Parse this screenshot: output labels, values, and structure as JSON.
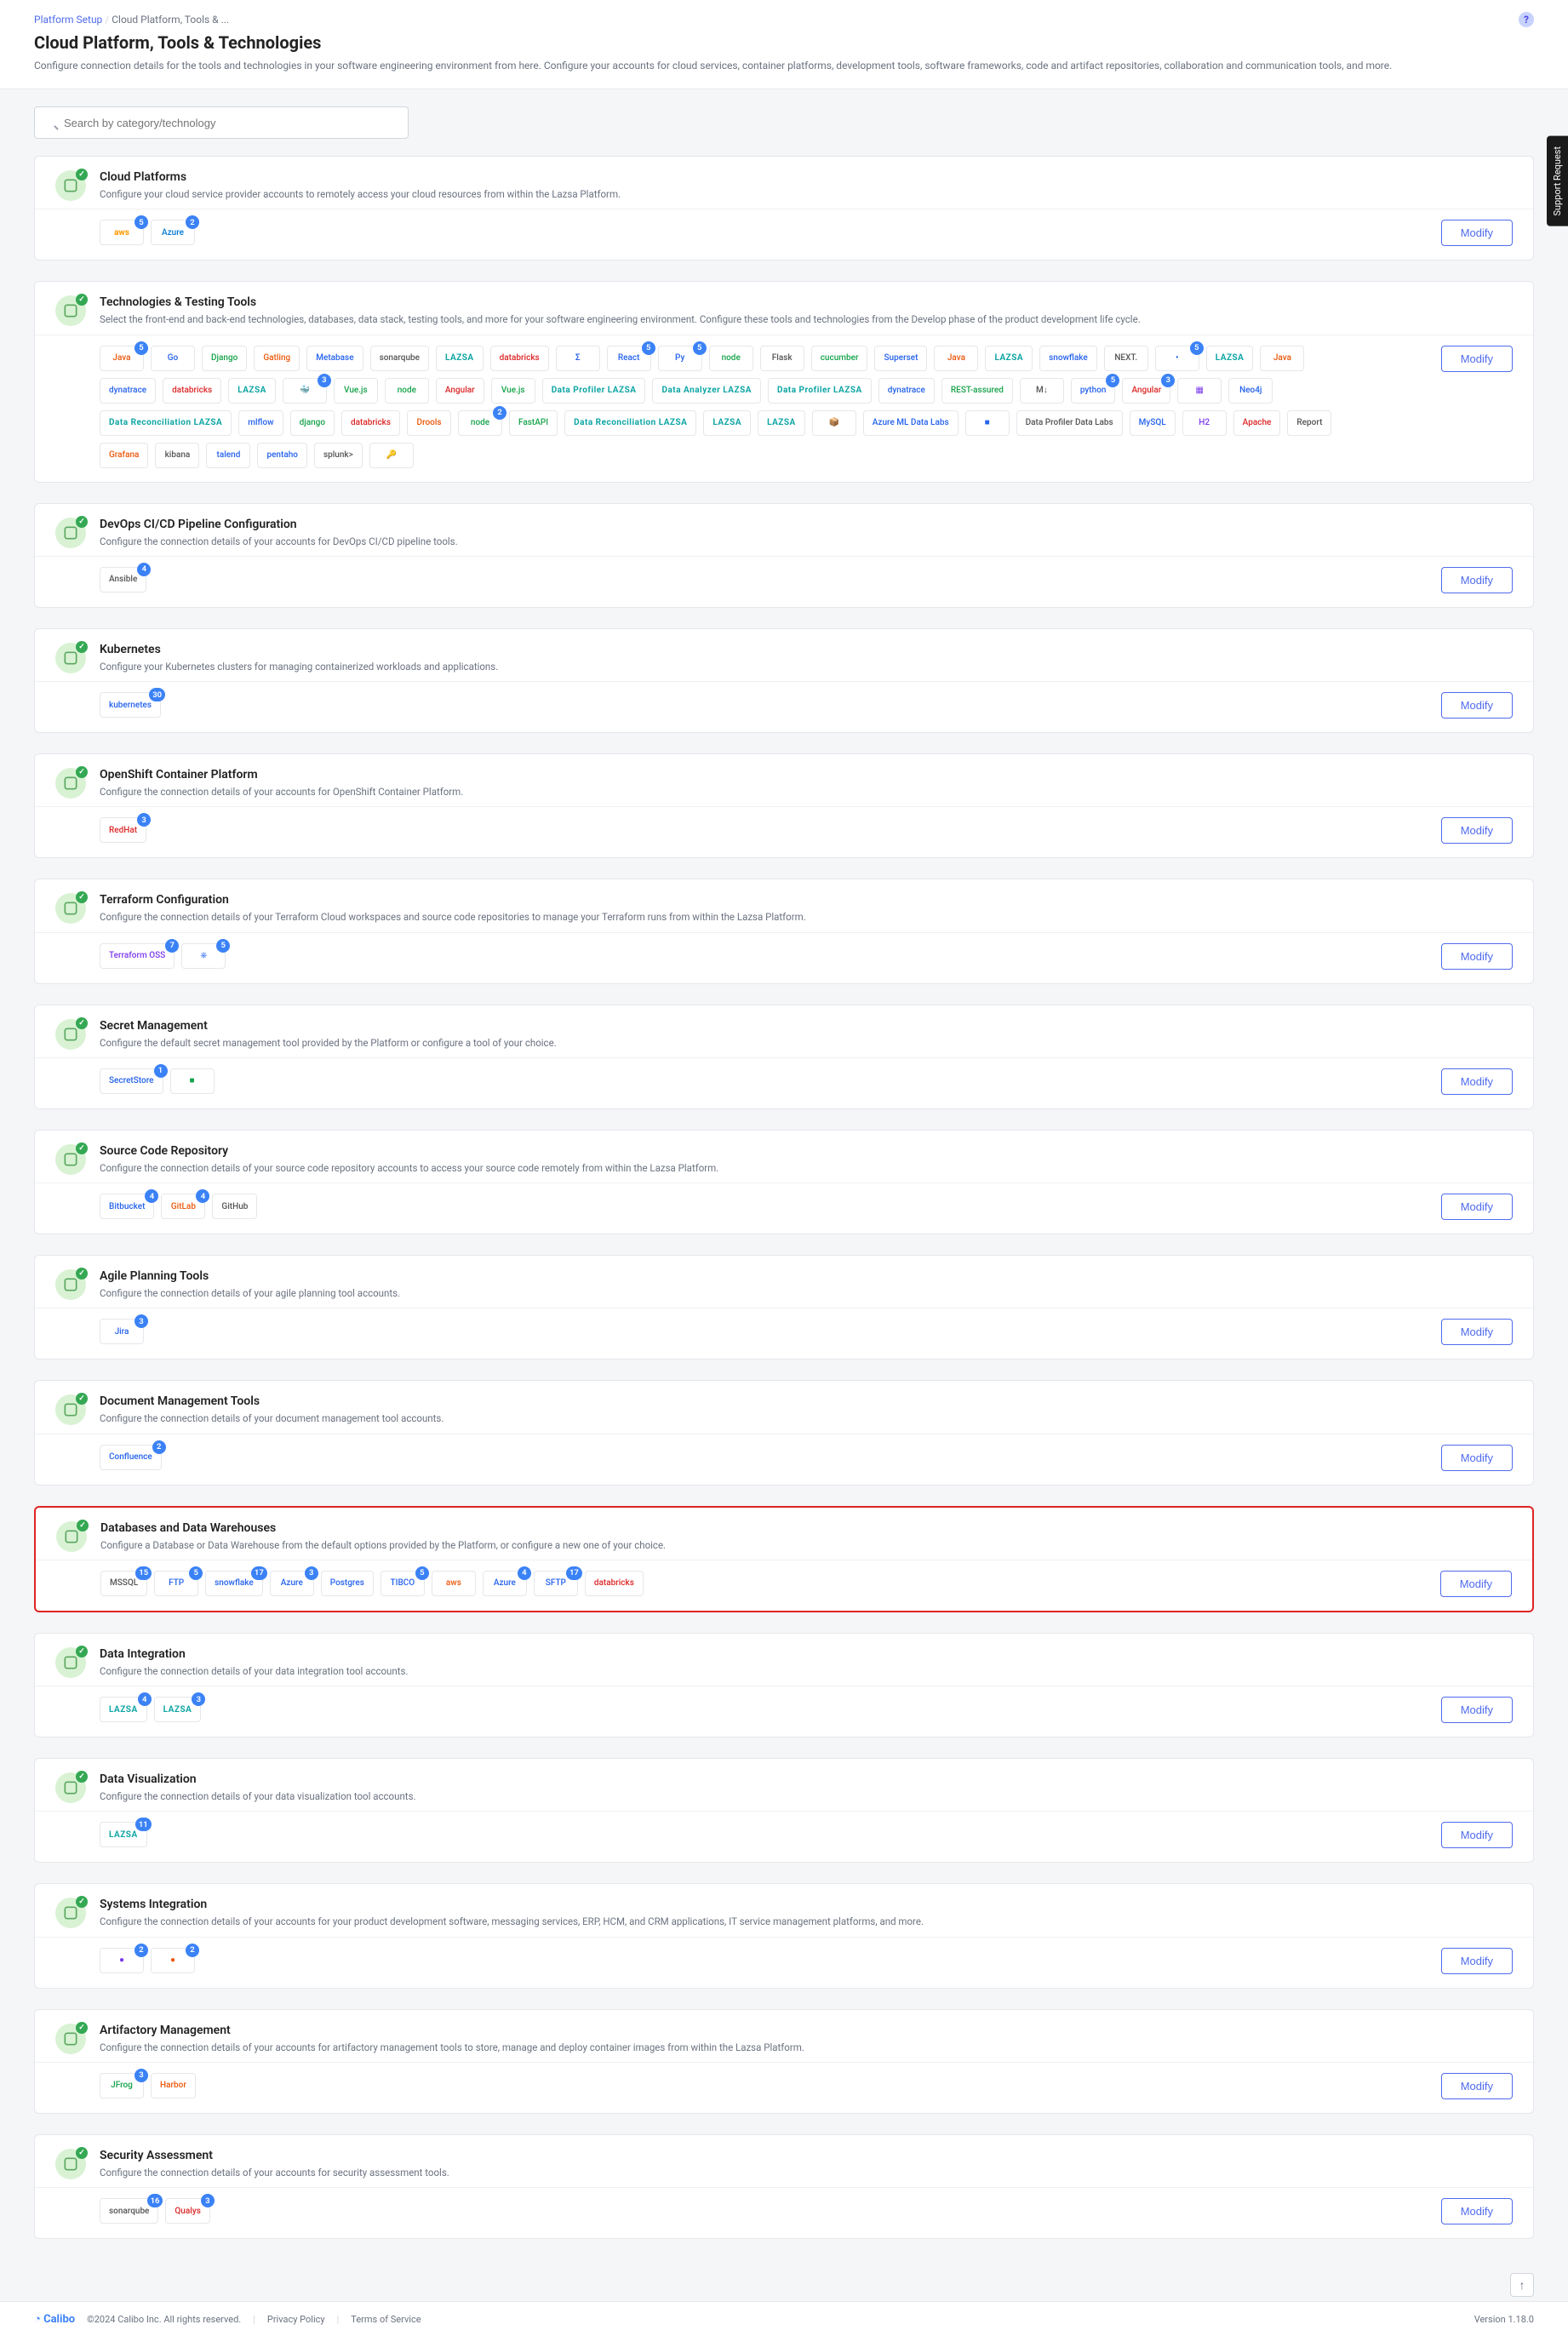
{
  "breadcrumb": {
    "root": "Platform Setup",
    "current": "Cloud Platform, Tools & ..."
  },
  "page_title": "Cloud Platform, Tools & Technologies",
  "page_subtitle": "Configure connection details for the tools and technologies in your software engineering environment from here. Configure your accounts for cloud services, container platforms, development tools, software frameworks, code and artifact repositories, collaboration and communication tools, and more.",
  "search_placeholder": "Search by category/technology",
  "modify_label": "Modify",
  "support_tab": "Support Request",
  "footer": {
    "brand": "Calibo",
    "copyright": "©2024 Calibo Inc. All rights reserved.",
    "privacy": "Privacy Policy",
    "terms": "Terms of Service",
    "version": "Version 1.18.0"
  },
  "cards": [
    {
      "id": "cloud-platforms",
      "title": "Cloud Platforms",
      "desc": "Configure your cloud service provider accounts to remotely access your cloud resources from within the Lazsa Platform.",
      "tiles": [
        {
          "name": "aws",
          "label": "aws",
          "badge": "5",
          "cls": "aws"
        },
        {
          "name": "azure",
          "label": "Azure",
          "badge": "2",
          "cls": "azure"
        }
      ]
    },
    {
      "id": "technologies-testing",
      "title": "Technologies & Testing Tools",
      "desc": "Select the front-end and back-end technologies, databases, data stack, testing tools, and more for your software engineering environment. Configure these tools and technologies from the Develop phase of the product development life cycle.",
      "tiles": [
        {
          "name": "java",
          "label": "Java",
          "badge": "5",
          "cls": "orange"
        },
        {
          "name": "go",
          "label": "Go",
          "badge": "",
          "cls": "blue"
        },
        {
          "name": "django-core",
          "label": "Django",
          "badge": "",
          "cls": "green"
        },
        {
          "name": "gatling",
          "label": "Gatling",
          "badge": "",
          "cls": "orange"
        },
        {
          "name": "metabase",
          "label": "Metabase",
          "badge": "",
          "cls": "blue"
        },
        {
          "name": "sonar1",
          "label": "sonarqube",
          "badge": "",
          "cls": ""
        },
        {
          "name": "lazsa-1",
          "label": "LAZSA",
          "badge": "",
          "cls": "lazsa"
        },
        {
          "name": "databricks-1",
          "label": "databricks",
          "badge": "",
          "cls": "red"
        },
        {
          "name": "sigma",
          "label": "Σ",
          "badge": "",
          "cls": "blue"
        },
        {
          "name": "react",
          "label": "React",
          "badge": "5",
          "cls": "blue"
        },
        {
          "name": "python",
          "label": "Py",
          "badge": "5",
          "cls": "blue"
        },
        {
          "name": "node-1",
          "label": "node",
          "badge": "",
          "cls": "green"
        },
        {
          "name": "flask",
          "label": "Flask",
          "badge": "",
          "cls": ""
        },
        {
          "name": "cucumber",
          "label": "cucumber",
          "badge": "",
          "cls": "green"
        },
        {
          "name": "superset",
          "label": "Superset",
          "badge": "",
          "cls": "blue"
        },
        {
          "name": "java-e",
          "label": "Java",
          "badge": "",
          "cls": "orange"
        },
        {
          "name": "lazsa-2",
          "label": "LAZSA",
          "badge": "",
          "cls": "lazsa"
        },
        {
          "name": "snowflake-1",
          "label": "snowflake",
          "badge": "",
          "cls": "blue"
        },
        {
          "name": "next",
          "label": "NEXT.",
          "badge": "",
          "cls": ""
        },
        {
          "name": "misc1",
          "label": "•",
          "badge": "5",
          "cls": "blue"
        },
        {
          "name": "lazsa-3",
          "label": "LAZSA",
          "badge": "",
          "cls": "lazsa"
        },
        {
          "name": "java2",
          "label": "Java",
          "badge": "",
          "cls": "orange"
        },
        {
          "name": "dynatrace",
          "label": "dynatrace",
          "badge": "",
          "cls": "blue"
        },
        {
          "name": "databricks2",
          "label": "databricks",
          "badge": "",
          "cls": "red"
        },
        {
          "name": "lazsa-4",
          "label": "LAZSA",
          "badge": "",
          "cls": "lazsa"
        },
        {
          "name": "docker",
          "label": "🐳",
          "badge": "3",
          "cls": "blue"
        },
        {
          "name": "vue",
          "label": "Vue.js",
          "badge": "",
          "cls": "green"
        },
        {
          "name": "node-2",
          "label": "node",
          "badge": "",
          "cls": "green"
        },
        {
          "name": "angular",
          "label": "Angular",
          "badge": "",
          "cls": "red"
        },
        {
          "name": "vuejs2",
          "label": "Vue.js",
          "badge": "",
          "cls": "green"
        },
        {
          "name": "data-profiler1",
          "label": "Data Profiler LAZSA",
          "badge": "",
          "cls": "lazsa"
        },
        {
          "name": "data-analyzer",
          "label": "Data Analyzer LAZSA",
          "badge": "",
          "cls": "lazsa"
        },
        {
          "name": "data-profiler2",
          "label": "Data Profiler LAZSA",
          "badge": "",
          "cls": "lazsa"
        },
        {
          "name": "dynatrace2",
          "label": "dynatrace",
          "badge": "",
          "cls": "blue"
        },
        {
          "name": "restassured",
          "label": "REST-assured",
          "badge": "",
          "cls": "green"
        },
        {
          "name": "markdown",
          "label": "M↓",
          "badge": "",
          "cls": ""
        },
        {
          "name": "python2",
          "label": "python",
          "badge": "5",
          "cls": "blue"
        },
        {
          "name": "angular2",
          "label": "Angular",
          "badge": "3",
          "cls": "red"
        },
        {
          "name": "apigw",
          "label": "▦",
          "badge": "",
          "cls": "purple"
        },
        {
          "name": "neo4j",
          "label": "Neo4j",
          "badge": "",
          "cls": "blue"
        },
        {
          "name": "data-recon",
          "label": "Data Reconciliation LAZSA",
          "badge": "",
          "cls": "lazsa"
        },
        {
          "name": "mlflow-1",
          "label": "mlflow",
          "badge": "",
          "cls": "blue"
        },
        {
          "name": "django-2",
          "label": "django",
          "badge": "",
          "cls": "green"
        },
        {
          "name": "databricks4",
          "label": "databricks",
          "badge": "",
          "cls": "red"
        },
        {
          "name": "drools",
          "label": "Drools",
          "badge": "",
          "cls": "orange"
        },
        {
          "name": "node-3",
          "label": "node",
          "badge": "2",
          "cls": "green"
        },
        {
          "name": "fastapi",
          "label": "FastAPI",
          "badge": "",
          "cls": "green"
        },
        {
          "name": "data-recon2",
          "label": "Data Reconciliation LAZSA",
          "badge": "",
          "cls": "lazsa"
        },
        {
          "name": "lazsa-6",
          "label": "LAZSA",
          "badge": "",
          "cls": "lazsa"
        },
        {
          "name": "lazsa-7",
          "label": "LAZSA",
          "badge": "",
          "cls": "lazsa"
        },
        {
          "name": "box",
          "label": "📦",
          "badge": "",
          "cls": ""
        },
        {
          "name": "azure-dl",
          "label": "Azure ML Data Labs",
          "badge": "",
          "cls": "blue"
        },
        {
          "name": "gemfire",
          "label": "■",
          "badge": "",
          "cls": "blue"
        },
        {
          "name": "data-profiler3",
          "label": "Data Profiler Data Labs",
          "badge": "",
          "cls": ""
        },
        {
          "name": "mysql",
          "label": "MySQL",
          "badge": "",
          "cls": "blue"
        },
        {
          "name": "h2",
          "label": "H2",
          "badge": "",
          "cls": "purple"
        },
        {
          "name": "apache",
          "label": "Apache",
          "badge": "",
          "cls": "red"
        },
        {
          "name": "report",
          "label": "Report",
          "badge": "",
          "cls": ""
        },
        {
          "name": "grafana",
          "label": "Grafana",
          "badge": "",
          "cls": "orange"
        },
        {
          "name": "kibana",
          "label": "kibana",
          "badge": "",
          "cls": ""
        },
        {
          "name": "talend",
          "label": "talend",
          "badge": "",
          "cls": "blue"
        },
        {
          "name": "pentaho",
          "label": "pentaho",
          "badge": "",
          "cls": "blue"
        },
        {
          "name": "splunk",
          "label": "splunk>",
          "badge": "",
          "cls": ""
        },
        {
          "name": "key",
          "label": "🔑",
          "badge": "",
          "cls": "orange"
        }
      ]
    },
    {
      "id": "devops-cicd",
      "title": "DevOps CI/CD Pipeline Configuration",
      "desc": "Configure the connection details of your accounts for DevOps CI/CD pipeline tools.",
      "tiles": [
        {
          "name": "ansible",
          "label": "Ansible",
          "badge": "4",
          "cls": ""
        }
      ]
    },
    {
      "id": "kubernetes",
      "title": "Kubernetes",
      "desc": "Configure your Kubernetes clusters for managing containerized workloads and applications.",
      "tiles": [
        {
          "name": "k8s",
          "label": "kubernetes",
          "badge": "30",
          "cls": "blue"
        }
      ]
    },
    {
      "id": "openshift",
      "title": "OpenShift Container Platform",
      "desc": "Configure the connection details of your accounts for OpenShift Container Platform.",
      "tiles": [
        {
          "name": "openshift-tile",
          "label": "RedHat",
          "badge": "3",
          "cls": "red"
        }
      ]
    },
    {
      "id": "terraform",
      "title": "Terraform Configuration",
      "desc": "Configure the connection details of your Terraform Cloud workspaces and source code repositories to manage your Terraform runs from within the Lazsa Platform.",
      "tiles": [
        {
          "name": "terraform-oss",
          "label": "Terraform OSS",
          "badge": "7",
          "cls": "purple"
        },
        {
          "name": "terraform-cloud",
          "label": "⎈",
          "badge": "5",
          "cls": "blue"
        }
      ]
    },
    {
      "id": "secret-mgmt",
      "title": "Secret Management",
      "desc": "Configure the default secret management tool provided by the Platform or configure a tool of your choice.",
      "tiles": [
        {
          "name": "secret-store",
          "label": "SecretStore",
          "badge": "1",
          "cls": "blue"
        },
        {
          "name": "vault",
          "label": "■",
          "badge": "",
          "cls": "green"
        }
      ]
    },
    {
      "id": "source-code",
      "title": "Source Code Repository",
      "desc": "Configure the connection details of your source code repository accounts to access your source code remotely from within the Lazsa Platform.",
      "tiles": [
        {
          "name": "bitbucket",
          "label": "Bitbucket",
          "badge": "4",
          "cls": "blue"
        },
        {
          "name": "gitlab",
          "label": "GitLab",
          "badge": "4",
          "cls": "orange"
        },
        {
          "name": "github",
          "label": "GitHub",
          "badge": "",
          "cls": ""
        }
      ]
    },
    {
      "id": "agile",
      "title": "Agile Planning Tools",
      "desc": "Configure the connection details of your agile planning tool accounts.",
      "tiles": [
        {
          "name": "jira",
          "label": "Jira",
          "badge": "3",
          "cls": "blue"
        }
      ]
    },
    {
      "id": "docman",
      "title": "Document Management Tools",
      "desc": "Configure the connection details of your document management tool accounts.",
      "tiles": [
        {
          "name": "confluence",
          "label": "Confluence",
          "badge": "2",
          "cls": "blue"
        }
      ]
    },
    {
      "id": "databases",
      "title": "Databases and Data Warehouses",
      "desc": "Configure a Database or Data Warehouse from the default options provided by the Platform, or configure a new one of your choice.",
      "highlighted": true,
      "tiles": [
        {
          "name": "mssql",
          "label": "MSSQL",
          "badge": "15",
          "cls": ""
        },
        {
          "name": "ftp",
          "label": "FTP",
          "badge": "5",
          "cls": "blue"
        },
        {
          "name": "snowflake",
          "label": "snowflake",
          "badge": "17",
          "cls": "blue"
        },
        {
          "name": "azuredb",
          "label": "Azure",
          "badge": "3",
          "cls": "blue"
        },
        {
          "name": "postgres",
          "label": "Postgres",
          "badge": "",
          "cls": "blue"
        },
        {
          "name": "tibco",
          "label": "TIBCO",
          "badge": "5",
          "cls": "blue"
        },
        {
          "name": "aws-s3",
          "label": "aws",
          "badge": "",
          "cls": "orange"
        },
        {
          "name": "azure-dl2",
          "label": "Azure",
          "badge": "4",
          "cls": "blue"
        },
        {
          "name": "sftp",
          "label": "SFTP",
          "badge": "17",
          "cls": "blue"
        },
        {
          "name": "databricks-db",
          "label": "databricks",
          "badge": "",
          "cls": "red"
        }
      ]
    },
    {
      "id": "data-integration",
      "title": "Data Integration",
      "desc": "Configure the connection details of your data integration tool accounts.",
      "tiles": [
        {
          "name": "di-lazsa1",
          "label": "LAZSA",
          "badge": "4",
          "cls": "lazsa"
        },
        {
          "name": "di-lazsa2",
          "label": "LAZSA",
          "badge": "3",
          "cls": "lazsa"
        }
      ]
    },
    {
      "id": "data-viz",
      "title": "Data Visualization",
      "desc": "Configure the connection details of your data visualization tool accounts.",
      "tiles": [
        {
          "name": "dv-lazsa",
          "label": "LAZSA",
          "badge": "11",
          "cls": "lazsa"
        }
      ]
    },
    {
      "id": "systems-integration",
      "title": "Systems Integration",
      "desc": "Configure the connection details of your accounts for your product development software, messaging services, ERP, HCM, and CRM applications, IT service management platforms, and more.",
      "tiles": [
        {
          "name": "si-1",
          "label": "●",
          "badge": "2",
          "cls": "purple"
        },
        {
          "name": "si-2",
          "label": "●",
          "badge": "2",
          "cls": "orange"
        }
      ]
    },
    {
      "id": "artifactory",
      "title": "Artifactory Management",
      "desc": "Configure the connection details of your accounts for artifactory management tools to store, manage and deploy container images from within the Lazsa Platform.",
      "tiles": [
        {
          "name": "jfrog",
          "label": "JFrog",
          "badge": "3",
          "cls": "green"
        },
        {
          "name": "harbor",
          "label": "Harbor",
          "badge": "",
          "cls": "orange"
        }
      ]
    },
    {
      "id": "security-assess",
      "title": "Security Assessment",
      "desc": "Configure the connection details of your accounts for security assessment tools.",
      "tiles": [
        {
          "name": "sonarqube",
          "label": "sonarqube",
          "badge": "16",
          "cls": ""
        },
        {
          "name": "qualys",
          "label": "Qualys",
          "badge": "3",
          "cls": "red"
        }
      ]
    }
  ]
}
